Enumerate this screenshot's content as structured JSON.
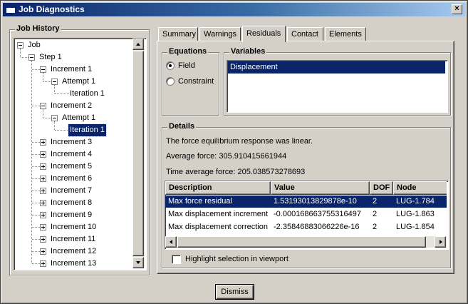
{
  "window": {
    "title": "Job Diagnostics",
    "close_glyph": "×"
  },
  "job_history": {
    "legend": "Job History",
    "tree": [
      {
        "label": "Job",
        "depth": 0,
        "toggle": "minus",
        "selected": false
      },
      {
        "label": "Step 1",
        "depth": 1,
        "toggle": "minus",
        "selected": false
      },
      {
        "label": "Increment 1",
        "depth": 2,
        "toggle": "minus",
        "selected": false
      },
      {
        "label": "Attempt 1",
        "depth": 3,
        "toggle": "minus",
        "selected": false
      },
      {
        "label": "Iteration 1",
        "depth": 4,
        "toggle": "none",
        "selected": false
      },
      {
        "label": "Increment 2",
        "depth": 2,
        "toggle": "minus",
        "selected": false
      },
      {
        "label": "Attempt 1",
        "depth": 3,
        "toggle": "minus",
        "selected": false
      },
      {
        "label": "Iteration 1",
        "depth": 4,
        "toggle": "none",
        "selected": true
      },
      {
        "label": "Increment 3",
        "depth": 2,
        "toggle": "plus",
        "selected": false
      },
      {
        "label": "Increment 4",
        "depth": 2,
        "toggle": "plus",
        "selected": false
      },
      {
        "label": "Increment 5",
        "depth": 2,
        "toggle": "plus",
        "selected": false
      },
      {
        "label": "Increment 6",
        "depth": 2,
        "toggle": "plus",
        "selected": false
      },
      {
        "label": "Increment 7",
        "depth": 2,
        "toggle": "plus",
        "selected": false
      },
      {
        "label": "Increment 8",
        "depth": 2,
        "toggle": "plus",
        "selected": false
      },
      {
        "label": "Increment 9",
        "depth": 2,
        "toggle": "plus",
        "selected": false
      },
      {
        "label": "Increment 10",
        "depth": 2,
        "toggle": "plus",
        "selected": false
      },
      {
        "label": "Increment 11",
        "depth": 2,
        "toggle": "plus",
        "selected": false
      },
      {
        "label": "Increment 12",
        "depth": 2,
        "toggle": "plus",
        "selected": false
      },
      {
        "label": "Increment 13",
        "depth": 2,
        "toggle": "plus",
        "selected": false
      }
    ]
  },
  "tabs": [
    {
      "label": "Summary",
      "active": false
    },
    {
      "label": "Warnings",
      "active": false
    },
    {
      "label": "Residuals",
      "active": true
    },
    {
      "label": "Contact",
      "active": false
    },
    {
      "label": "Elements",
      "active": false
    }
  ],
  "equations": {
    "legend": "Equations",
    "options": [
      {
        "label": "Field",
        "checked": true
      },
      {
        "label": "Constraint",
        "checked": false
      }
    ]
  },
  "variables": {
    "legend": "Variables",
    "items": [
      {
        "label": "Displacement",
        "selected": true
      }
    ]
  },
  "details": {
    "legend": "Details",
    "message": "The force equilibrium response was linear.",
    "average_force": "Average force: 305.910415661944",
    "time_average_force": "Time average force: 205.038573278693",
    "table": {
      "columns": [
        "Description",
        "Value",
        "DOF",
        "Node"
      ],
      "rows": [
        {
          "cells": [
            "Max force residual",
            "1.53193013829878e-10",
            "2",
            "LUG-1.784"
          ],
          "selected": true
        },
        {
          "cells": [
            "Max displacement increment",
            "-0.000168663755316497",
            "2",
            "LUG-1.863"
          ],
          "selected": false
        },
        {
          "cells": [
            "Max displacement correction",
            "-2.35846883066226e-16",
            "2",
            "LUG-1.854"
          ],
          "selected": false
        }
      ]
    },
    "highlight_label": "Highlight selection in viewport",
    "highlight_checked": false
  },
  "dismiss_label": "Dismiss",
  "colors": {
    "face": "#d4d0c8",
    "selection": "#0a246a",
    "title_start": "#0a246a",
    "title_end": "#a6caf0"
  }
}
